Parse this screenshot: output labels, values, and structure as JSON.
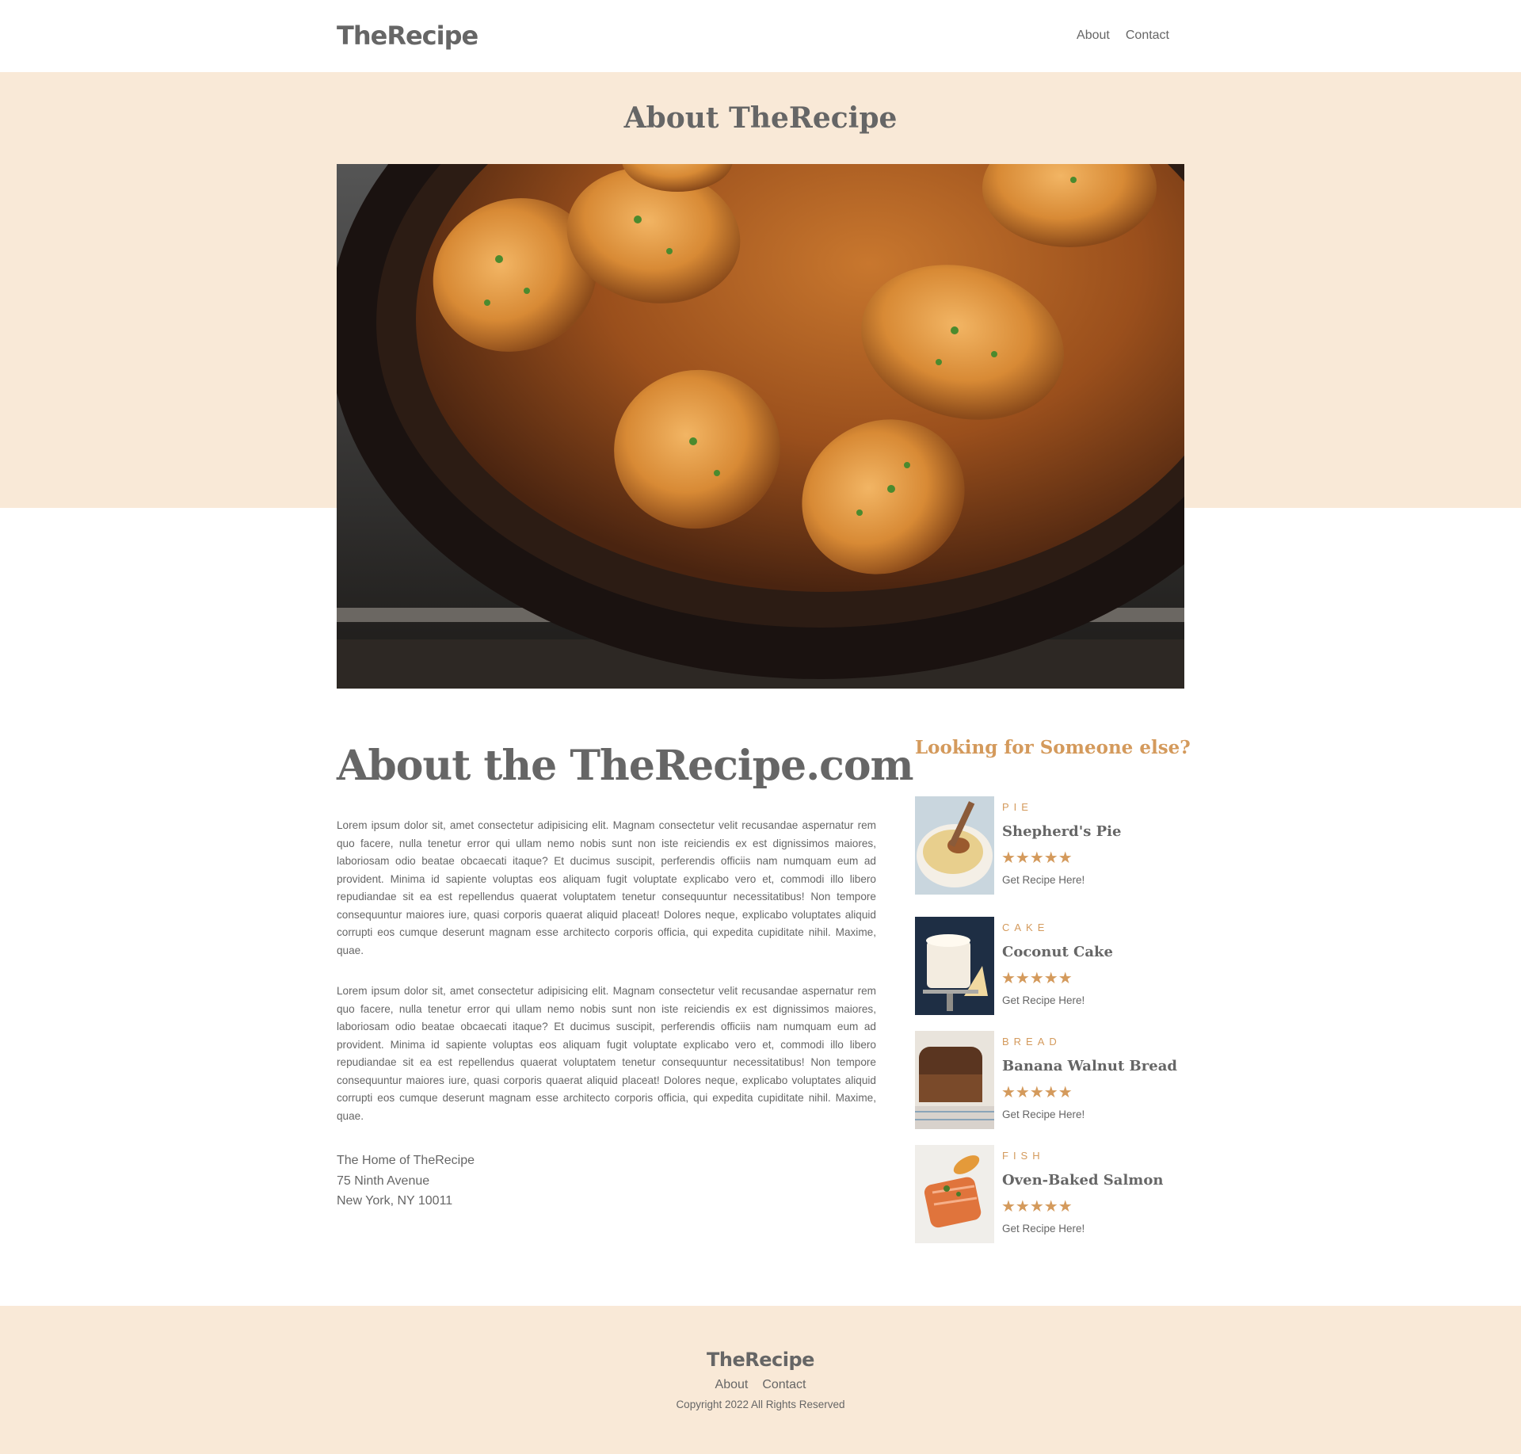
{
  "header": {
    "logo": "TheRecipe",
    "nav": [
      "About",
      "Contact"
    ]
  },
  "hero": {
    "title": "About TheRecipe",
    "image_alt": "Seared chicken thighs in a cast iron skillet with herbs"
  },
  "main": {
    "heading": "About the TheRecipe.com",
    "paragraphs": [
      "Lorem ipsum dolor sit, amet consectetur adipisicing elit. Magnam consectetur velit recusandae aspernatur rem quo facere, nulla tenetur error qui ullam nemo nobis sunt non iste reiciendis ex est dignissimos maiores, laboriosam odio beatae obcaecati itaque? Et ducimus suscipit, perferendis officiis nam numquam eum ad provident. Minima id sapiente voluptas eos aliquam fugit voluptate explicabo vero et, commodi illo libero repudiandae sit ea est repellendus quaerat voluptatem tenetur consequuntur necessitatibus! Non tempore consequuntur maiores iure, quasi corporis quaerat aliquid placeat! Dolores neque, explicabo voluptates aliquid corrupti eos cumque deserunt magnam esse architecto corporis officia, qui expedita cupiditate nihil. Maxime, quae.",
      "Lorem ipsum dolor sit, amet consectetur adipisicing elit. Magnam consectetur velit recusandae aspernatur rem quo facere, nulla tenetur error qui ullam nemo nobis sunt non iste reiciendis ex est dignissimos maiores, laboriosam odio beatae obcaecati itaque? Et ducimus suscipit, perferendis officiis nam numquam eum ad provident. Minima id sapiente voluptas eos aliquam fugit voluptate explicabo vero et, commodi illo libero repudiandae sit ea est repellendus quaerat voluptatem tenetur consequuntur necessitatibus! Non tempore consequuntur maiores iure, quasi corporis quaerat aliquid placeat! Dolores neque, explicabo voluptates aliquid corrupti eos cumque deserunt magnam esse architecto corporis officia, qui expedita cupiditate nihil. Maxime, quae."
    ],
    "address": [
      "The Home of TheRecipe",
      "75 Ninth Avenue",
      "New York, NY 10011"
    ]
  },
  "sidebar": {
    "heading": "Looking for Someone else?",
    "recipes": [
      {
        "category": "PIE",
        "name": "Shepherd's Pie",
        "rating": 5,
        "stars": "★★★★★",
        "link": "Get Recipe Here!",
        "thumb_icon": "pie-photo"
      },
      {
        "category": "CAKE",
        "name": "Coconut Cake",
        "rating": 5,
        "stars": "★★★★★",
        "link": "Get Recipe Here!",
        "thumb_icon": "cake-photo"
      },
      {
        "category": "BREAD",
        "name": "Banana Walnut Bread",
        "rating": 5,
        "stars": "★★★★★",
        "link": "Get Recipe Here!",
        "thumb_icon": "bread-photo"
      },
      {
        "category": "FISH",
        "name": "Oven-Baked Salmon",
        "rating": 5,
        "stars": "★★★★★",
        "link": "Get Recipe Here!",
        "thumb_icon": "salmon-photo"
      }
    ]
  },
  "footer": {
    "logo": "TheRecipe",
    "nav": [
      "About",
      "Contact"
    ],
    "copyright": "Copyright 2022 All Rights Reserved"
  },
  "colors": {
    "accent": "#d49a5c",
    "band": "#f9e9d7",
    "text": "#666666",
    "white": "#ffffff"
  }
}
